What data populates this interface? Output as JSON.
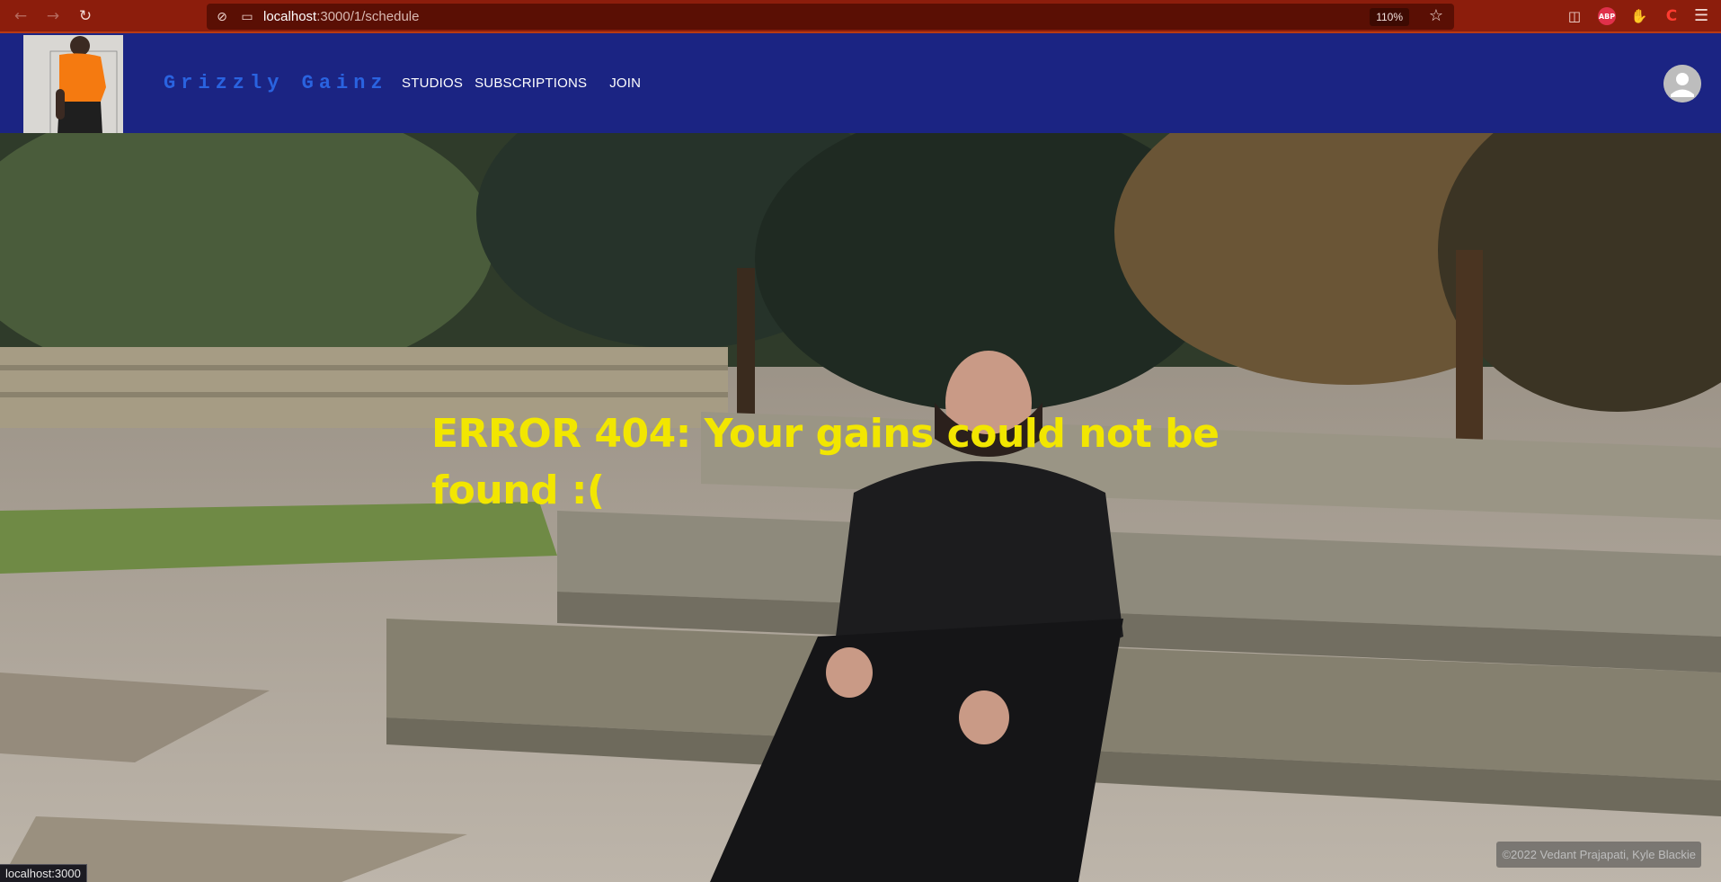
{
  "browser": {
    "url_host": "localhost",
    "url_path": ":3000/1/schedule",
    "zoom": "110%",
    "status_url": "localhost:3000"
  },
  "header": {
    "brand": "Grizzly Gainz",
    "nav": [
      "STUDIOS",
      "SUBSCRIPTIONS",
      "JOIN"
    ]
  },
  "main": {
    "error_message": "ERROR 404: Your gains could not be found :("
  },
  "footer": {
    "copyright": "©2022 Vedant Prajapati, Kyle Blackie"
  },
  "icons": {
    "back": "back-arrow-icon",
    "forward": "forward-arrow-icon",
    "reload": "reload-icon",
    "tracking": "tracking-protection-icon",
    "page": "page-info-icon",
    "bookmark": "star-icon",
    "pocket": "pocket-icon",
    "adblock": "adblock-icon",
    "menu": "hamburger-menu-icon",
    "avatar": "user-avatar-icon"
  },
  "colors": {
    "browser_bar": "#8c1d0c",
    "header_bg": "#1b2483",
    "brand_text": "#2a63e0",
    "error_text": "#f2e600"
  }
}
